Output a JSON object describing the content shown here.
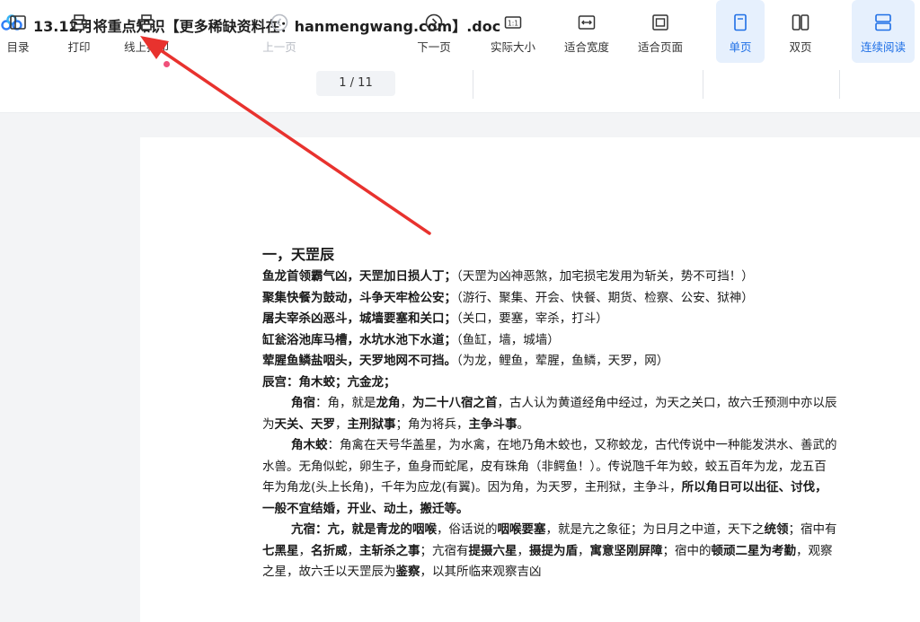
{
  "window": {
    "title": "13.12月将重点知识【更多稀缺资料在：hanmengwang.com】.doc"
  },
  "toolbar": {
    "toc": "目录",
    "print": "打印",
    "online_print": "线上打印",
    "prev_page": "上一页",
    "page_indicator": "1  / 11",
    "next_page": "下一页",
    "actual_size": "实际大小",
    "fit_width": "适合宽度",
    "fit_page": "适合页面",
    "single_page": "单页",
    "double_page": "双页",
    "continuous_read": "连续阅读"
  },
  "doc": {
    "heading": "一，天罡辰",
    "l1_b": "鱼龙首领霸气凶，天罡加日损人丁；",
    "l1_n": "（天罡为凶神恶煞，加宅损宅发用为斩关，势不可挡！）",
    "l2_b": "聚集快餐为鼓动，斗争天牢检公安；",
    "l2_n": "（游行、聚集、开会、快餐、期货、检察、公安、狱神）",
    "l3_b": "屠夫宰杀凶恶斗，城墙要塞和关口；",
    "l3_n": "（关口，要塞，宰杀，打斗）",
    "l4_b": "缸瓮浴池库马槽，水坑水池下水道；",
    "l4_n": "（鱼缸，墙，城墙）",
    "l5_b": "荤腥鱼鳞盐咽头，天罗地网不可挡。",
    "l5_n": "（为龙，鲤鱼，荤腥，鱼鳞，天罗，网）",
    "l6_b": "辰宫：角木蛟；亢金龙；",
    "p1_a": "角宿",
    "p1_b": "：角，就是",
    "p1_c": "龙角",
    "p1_d": "，",
    "p1_e": "为二十八宿之首",
    "p1_f": "，古人认为黄道经角中经过，为天之关口，故六壬预测中亦以辰为",
    "p1_g": "天关、天罗",
    "p1_h": "，",
    "p1_i": "主刑狱事",
    "p1_j": "；角为将兵，",
    "p1_k": "主争斗事",
    "p1_l": "。",
    "p2_a": "角木蛟",
    "p2_b": "：角禽在天号华盖星，为水禽，在地乃角木蛟也，又称蛟龙，古代传说中一种能发洪水、善武的水兽。无角似蛇，卵生子，鱼身而蛇尾，皮有珠角（非鳄鱼！）。传说虺千年为蛟，蛟五百年为龙，龙五百年为角龙(头上长角)，千年为应龙(有翼)。因为角，为天罗，主刑狱，主争斗，",
    "p2_c": "所以角日可以出征、讨伐，一般不宜结婚，开业、动土，搬迁等。",
    "p3_a": "亢宿：亢，就是青龙的咽喉",
    "p3_b": "，俗话说的",
    "p3_c": "咽喉要塞",
    "p3_d": "，就是亢之象征；为日月之中道，天下之",
    "p3_e": "统领",
    "p3_f": "；宿中有",
    "p3_g": "七黑星",
    "p3_h": "，",
    "p3_i": "名折威",
    "p3_j": "，",
    "p3_k": "主斩杀之事",
    "p3_l": "；亢宿有",
    "p3_m": "提摄六星",
    "p3_n": "，",
    "p3_o": "摄提为盾",
    "p3_p": "，",
    "p3_q": "寓意坚刚屏障",
    "p3_r": "；宿中的",
    "p3_s": "顿顽二星为考勤",
    "p3_t": "，观察之星，故六壬以天罡辰为",
    "p3_u": "鉴察",
    "p3_v": "，以其所临来观察吉凶"
  },
  "colors": {
    "accent": "#1e6fe6",
    "arrow": "#e8322e",
    "active_bg": "#e6f0fd"
  }
}
